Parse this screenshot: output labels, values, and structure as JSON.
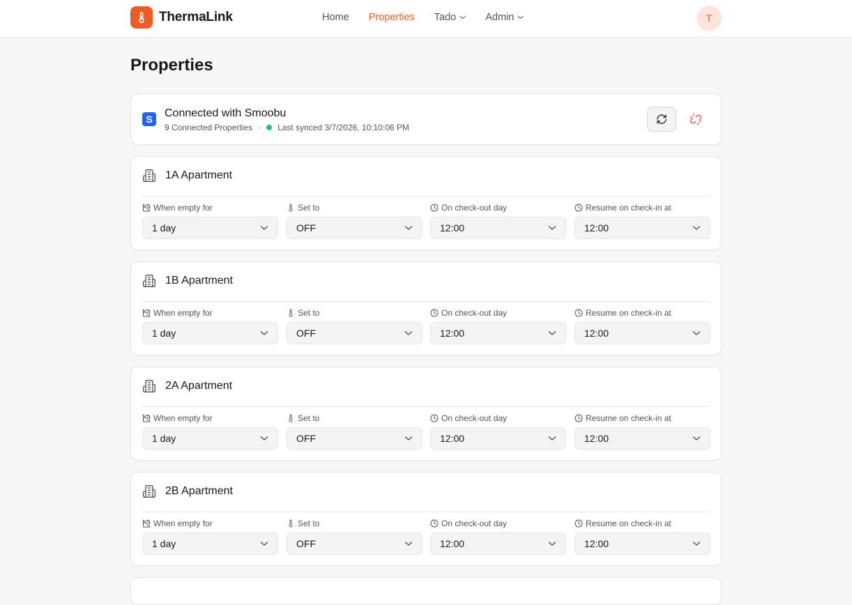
{
  "app": {
    "name": "ThermaLink",
    "avatar_initial": "T",
    "accent": "#f05a24"
  },
  "nav": {
    "items": [
      {
        "label": "Home",
        "active": false,
        "dropdown": false
      },
      {
        "label": "Properties",
        "active": true,
        "dropdown": false
      },
      {
        "label": "Tado",
        "active": false,
        "dropdown": true
      },
      {
        "label": "Admin",
        "active": false,
        "dropdown": true
      }
    ]
  },
  "page": {
    "title": "Properties"
  },
  "connection": {
    "icon_letter": "S",
    "title": "Connected with Smoobu",
    "count": "9 Connected Properties",
    "separator": "·",
    "last_synced": "Last synced 3/7/2026, 10:10:06 PM",
    "status_color": "#22c55e"
  },
  "field_labels": {
    "empty": "When empty for",
    "set_to": "Set to",
    "checkout": "On check-out day",
    "checkin": "Resume on check-in at"
  },
  "properties": [
    {
      "name": "1A Apartment",
      "empty": "1 day",
      "set_to": "OFF",
      "checkout": "12:00",
      "checkin": "12:00"
    },
    {
      "name": "1B Apartment",
      "empty": "1 day",
      "set_to": "OFF",
      "checkout": "12:00",
      "checkin": "12:00"
    },
    {
      "name": "2A Apartment",
      "empty": "1 day",
      "set_to": "OFF",
      "checkout": "12:00",
      "checkin": "12:00"
    },
    {
      "name": "2B Apartment",
      "empty": "1 day",
      "set_to": "OFF",
      "checkout": "12:00",
      "checkin": "12:00"
    }
  ]
}
